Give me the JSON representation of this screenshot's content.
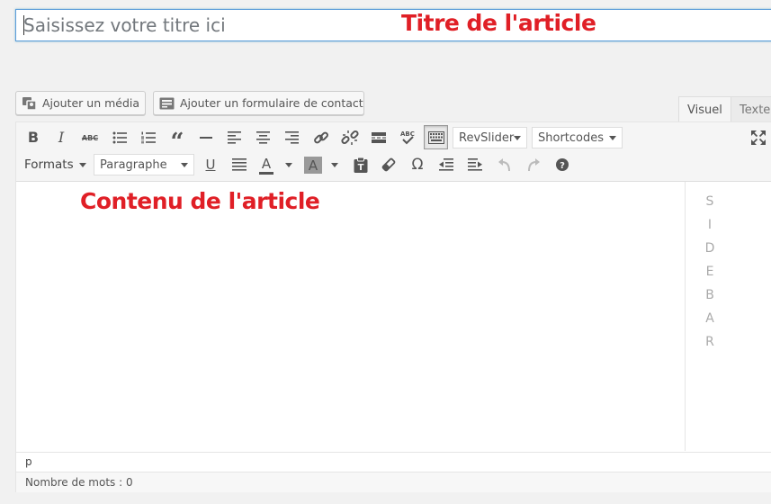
{
  "title": {
    "placeholder": "Saisissez votre titre ici",
    "annotation": "Titre de l'article"
  },
  "media_buttons": {
    "add_media": "Ajouter un média",
    "add_contact_form": "Ajouter un formulaire de contact"
  },
  "tabs": {
    "visual": "Visuel",
    "text": "Texte"
  },
  "toolbar": {
    "row1_dropdowns": {
      "revslider": "RevSlider",
      "shortcodes": "Shortcodes"
    },
    "row2_dropdowns": {
      "formats": "Formats",
      "paragraph": "Paragraphe"
    },
    "row1_icons": [
      "bold-icon",
      "italic-icon",
      "strikethrough-icon",
      "bullet-list-icon",
      "numbered-list-icon",
      "blockquote-icon",
      "horizontal-rule-icon",
      "align-left-icon",
      "align-center-icon",
      "align-right-icon",
      "link-icon",
      "unlink-icon",
      "read-more-icon",
      "spellcheck-icon",
      "toolbar-toggle-icon",
      "fullscreen-icon"
    ],
    "row2_icons": [
      "underline-icon",
      "justify-icon",
      "text-color-icon",
      "background-color-icon",
      "paste-as-text-icon",
      "clear-formatting-icon",
      "special-character-icon",
      "outdent-icon",
      "indent-icon",
      "undo-icon",
      "redo-icon",
      "help-icon"
    ],
    "glyphs": {
      "bold": "B",
      "italic": "I",
      "strike": "ABC",
      "quote": "“",
      "omega": "Ω",
      "text_color_letter": "A",
      "bg_color_letter": "A",
      "underline": "U"
    }
  },
  "content": {
    "annotation": "Contenu de l'article",
    "sidebar_letters": [
      "S",
      "I",
      "D",
      "E",
      "B",
      "A",
      "R"
    ]
  },
  "status": {
    "path": "p",
    "word_count": "Nombre de mots : 0"
  },
  "colors": {
    "annotation_red": "#e01f26",
    "focus_blue": "#5b9dd9"
  }
}
